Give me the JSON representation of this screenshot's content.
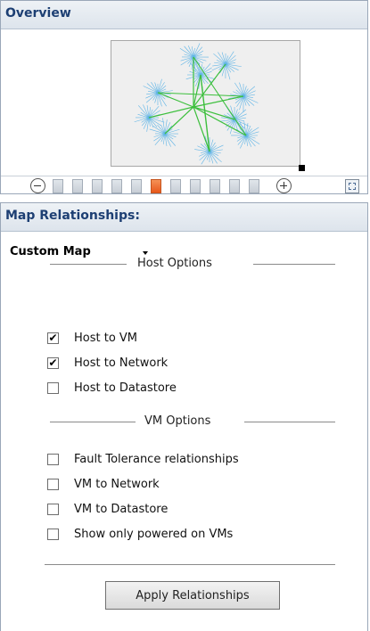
{
  "overview": {
    "title": "Overview",
    "zoom": {
      "steps": 11,
      "active_step": 6
    }
  },
  "relationships": {
    "title": "Map Relationships:",
    "map_selector": "Custom Map",
    "host_section": "Host Options",
    "host_options": [
      {
        "label": "Host to VM",
        "checked": true
      },
      {
        "label": "Host to Network",
        "checked": true
      },
      {
        "label": "Host to Datastore",
        "checked": false
      }
    ],
    "vm_section": "VM Options",
    "vm_options": [
      {
        "label": "Fault Tolerance relationships",
        "checked": false
      },
      {
        "label": "VM to Network",
        "checked": false
      },
      {
        "label": "VM to Datastore",
        "checked": false
      },
      {
        "label": "Show only powered on VMs",
        "checked": false
      }
    ],
    "apply_label": "Apply Relationships"
  },
  "colors": {
    "header_text": "#1d3f73",
    "map_hub_edges": "#3cbf3c",
    "map_leaf_edges": "#5fb4e6",
    "zoom_active": "#e8581c"
  },
  "icons": {
    "zoom_out": "minus-circle-icon",
    "zoom_in": "plus-circle-icon",
    "fit": "fit-to-window-icon",
    "dropdown": "caret-down-icon"
  }
}
